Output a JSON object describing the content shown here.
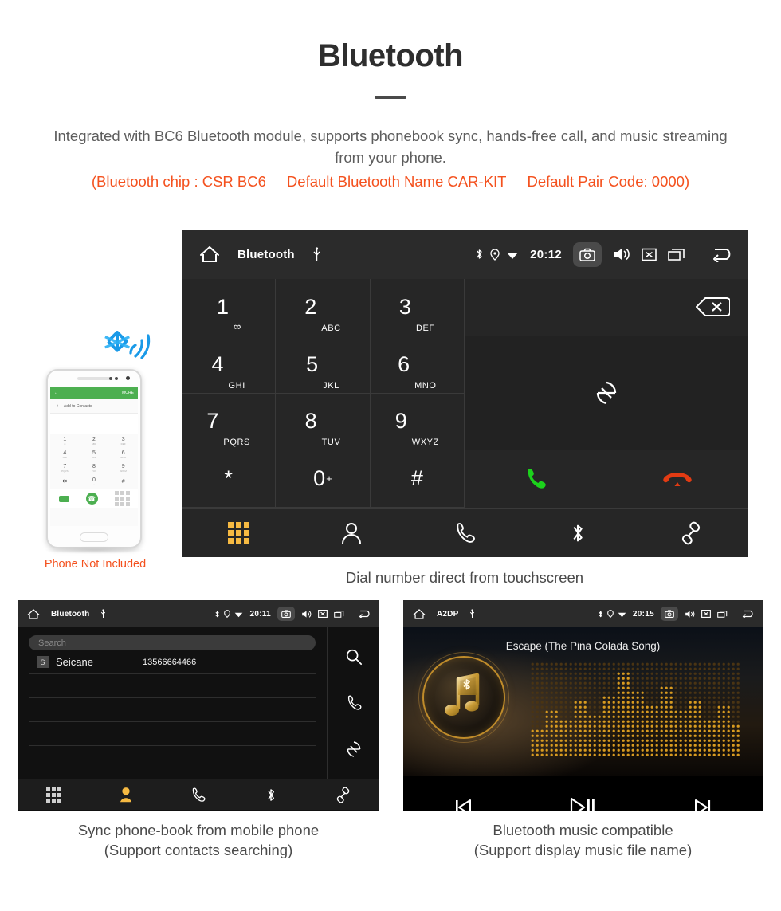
{
  "hero": {
    "title": "Bluetooth",
    "description": "Integrated with BC6 Bluetooth module, supports phonebook sync, hands-free call, and music streaming from your phone.",
    "spec_open": "(Bluetooth chip : CSR BC6",
    "spec_name": "Default Bluetooth Name CAR-KIT",
    "spec_code": "Default Pair Code: 0000)",
    "accent_color": "#f4511e",
    "text_color": "#5d5d5d"
  },
  "dialer": {
    "statusbar": {
      "home_icon": "home-icon",
      "title": "Bluetooth",
      "usb_icon": "usb-icon",
      "bluetooth_icon": "bluetooth-icon",
      "location_icon": "location-pin-icon",
      "wifi_icon": "wifi-icon",
      "time": "20:12",
      "camera_icon": "camera-icon",
      "volume_icon": "volume-icon",
      "close_icon": "close-box-icon",
      "recents_icon": "recents-icon",
      "back_icon": "back-arrow-icon"
    },
    "keys": [
      {
        "num": "1",
        "sub": "",
        "voicemail": true
      },
      {
        "num": "2",
        "sub": "ABC"
      },
      {
        "num": "3",
        "sub": "DEF"
      },
      {
        "num": "4",
        "sub": "GHI"
      },
      {
        "num": "5",
        "sub": "JKL"
      },
      {
        "num": "6",
        "sub": "MNO"
      },
      {
        "num": "7",
        "sub": "PQRS"
      },
      {
        "num": "8",
        "sub": "TUV"
      },
      {
        "num": "9",
        "sub": "WXYZ"
      },
      {
        "num": "*",
        "sub": ""
      },
      {
        "num": "0",
        "sup": "+"
      },
      {
        "num": "#",
        "sub": ""
      }
    ],
    "number_display": "",
    "backspace_icon": "backspace-icon",
    "sync_icon": "sync-icon",
    "call_icon": "call-icon",
    "hangup_icon": "hangup-icon",
    "call_color": "#1cd21c",
    "hangup_color": "#e23b13",
    "tabs": [
      {
        "name": "dialpad",
        "icon": "dialpad-icon",
        "active": true
      },
      {
        "name": "contacts",
        "icon": "contact-person-icon",
        "active": false
      },
      {
        "name": "history",
        "icon": "call-history-icon",
        "active": false
      },
      {
        "name": "bluetooth",
        "icon": "bluetooth-icon",
        "active": false
      },
      {
        "name": "pair",
        "icon": "link-pair-icon",
        "active": false
      }
    ],
    "active_color": "#f5b942",
    "caption": "Dial number direct from touchscreen"
  },
  "phone_mockup": {
    "screen_more_label": "MORE",
    "screen_back_icon": "back-arrow-icon",
    "add_contacts_label": "Add to Contacts",
    "keys": [
      {
        "num": "1",
        "sub": "∞"
      },
      {
        "num": "2",
        "sub": "ABC"
      },
      {
        "num": "3",
        "sub": "DEF"
      },
      {
        "num": "4",
        "sub": "GHI"
      },
      {
        "num": "5",
        "sub": "JKL"
      },
      {
        "num": "6",
        "sub": "MNO"
      },
      {
        "num": "7",
        "sub": "PQRS"
      },
      {
        "num": "8",
        "sub": "TUV"
      },
      {
        "num": "9",
        "sub": "WXYZ"
      },
      {
        "num": "✻",
        "sub": ""
      },
      {
        "num": "0",
        "sub": "+"
      },
      {
        "num": "#",
        "sub": ""
      }
    ],
    "note": "Phone Not Included",
    "note_color": "#f4511e",
    "bluetooth_signal_icon": "bluetooth-signal-icon"
  },
  "phonebook": {
    "statusbar": {
      "title": "Bluetooth",
      "time": "20:11"
    },
    "search_placeholder": "Search",
    "contacts": [
      {
        "initial": "S",
        "name": "Seicane",
        "number": "13566664466"
      }
    ],
    "side_actions": [
      {
        "name": "search",
        "icon": "search-icon"
      },
      {
        "name": "call",
        "icon": "call-history-icon"
      },
      {
        "name": "sync",
        "icon": "sync-icon"
      }
    ],
    "tabs": [
      {
        "name": "dialpad",
        "icon": "dialpad-icon",
        "active": false
      },
      {
        "name": "contacts",
        "icon": "contact-person-icon",
        "active": true
      },
      {
        "name": "history",
        "icon": "call-history-icon",
        "active": false
      },
      {
        "name": "bluetooth",
        "icon": "bluetooth-icon",
        "active": false
      },
      {
        "name": "pair",
        "icon": "link-pair-icon",
        "active": false
      }
    ],
    "caption_line1": "Sync phone-book from mobile phone",
    "caption_line2": "(Support contacts searching)"
  },
  "music": {
    "statusbar": {
      "title": "A2DP",
      "time": "20:15"
    },
    "track_title": "Escape (The Pina Colada Song)",
    "album_icon": "music-note-bluetooth-icon",
    "controls": [
      {
        "name": "previous",
        "icon": "previous-track-icon"
      },
      {
        "name": "play-pause",
        "icon": "play-pause-icon"
      },
      {
        "name": "next",
        "icon": "next-track-icon"
      }
    ],
    "caption_line1": "Bluetooth music compatible",
    "caption_line2": "(Support display music file name)"
  }
}
